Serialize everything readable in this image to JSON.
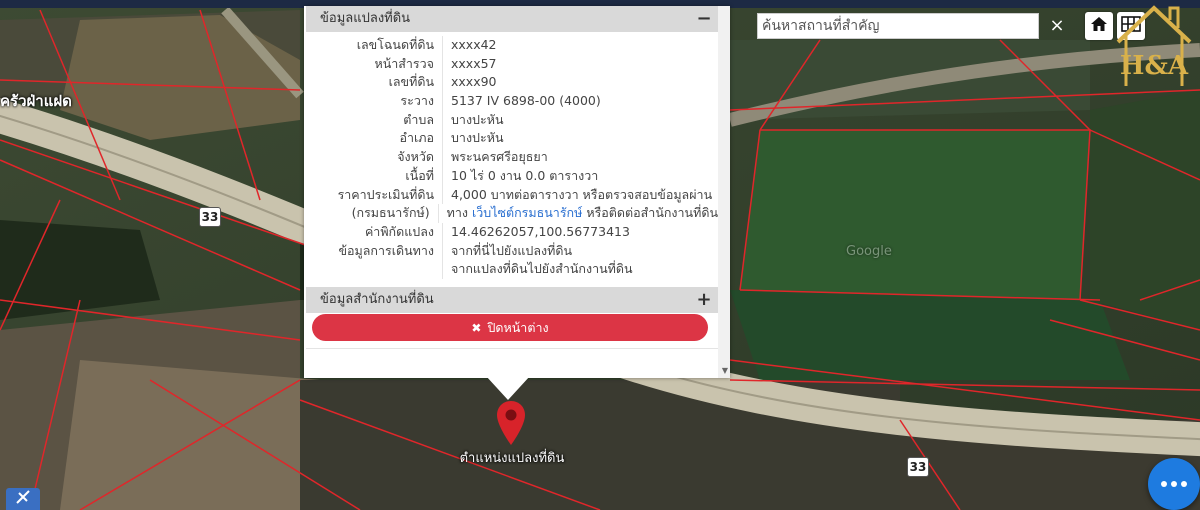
{
  "map": {
    "place_label": "ครัวฝ่าแฝด",
    "road_number_1": "33",
    "road_number_2": "33",
    "pin_label": "ตำแหน่งแปลงที่ดิน",
    "satellite_watermark": "Google"
  },
  "search": {
    "placeholder": "ค้นหาสถานที่สำคัญ",
    "value": "",
    "clear_label": "×"
  },
  "brand": {
    "logo_text": "H&A",
    "accent": "#d9b14a"
  },
  "popup": {
    "land_section_title": "ข้อมูลแปลงที่ดิน",
    "land_section_toggle": "−",
    "rows": [
      {
        "label": "เลขโฉนดที่ดิน",
        "value": "xxxx42"
      },
      {
        "label": "หน้าสำรวจ",
        "value": "xxxx57"
      },
      {
        "label": "เลขที่ดิน",
        "value": "xxxx90"
      },
      {
        "label": "ระวาง",
        "value": "5137 IV 6898-00 (4000)"
      },
      {
        "label": "ตำบล",
        "value": "บางปะหัน"
      },
      {
        "label": "อำเภอ",
        "value": "บางปะหัน"
      },
      {
        "label": "จังหวัด",
        "value": "พระนครศรีอยุธยา"
      },
      {
        "label": "เนื้อที่",
        "value": "10 ไร่ 0 งาน 0.0 ตารางวา"
      }
    ],
    "price_label": "ราคาประเมินที่ดิน",
    "price_value": "4,000 บาทต่อตารางวา หรือตรวจสอบข้อมูลผ่าน",
    "dept_label": "(กรมธนารักษ์)",
    "dept_text_pre": "ทาง",
    "dept_link": "เว็บไซต์กรมธนารักษ์",
    "dept_text_post": "หรือติดต่อสำนักงานที่ดิน",
    "coord_label": "ค่าพิกัดแปลง",
    "coord_value": "14.46262057,100.56773413",
    "travel_label": "ข้อมูลการเดินทาง",
    "travel_link_1": "จากที่นี่ไปยังแปลงที่ดิน",
    "travel_link_2": "จากแปลงที่ดินไปยังสำนักงานที่ดิน",
    "office_section_title": "ข้อมูลสำนักงานที่ดิน",
    "office_section_toggle": "+",
    "close_button_label": "ปิดหน้าต่าง",
    "close_button_icon": "✖",
    "close_color": "#dc3545",
    "link_color": "#2a6fd0"
  }
}
